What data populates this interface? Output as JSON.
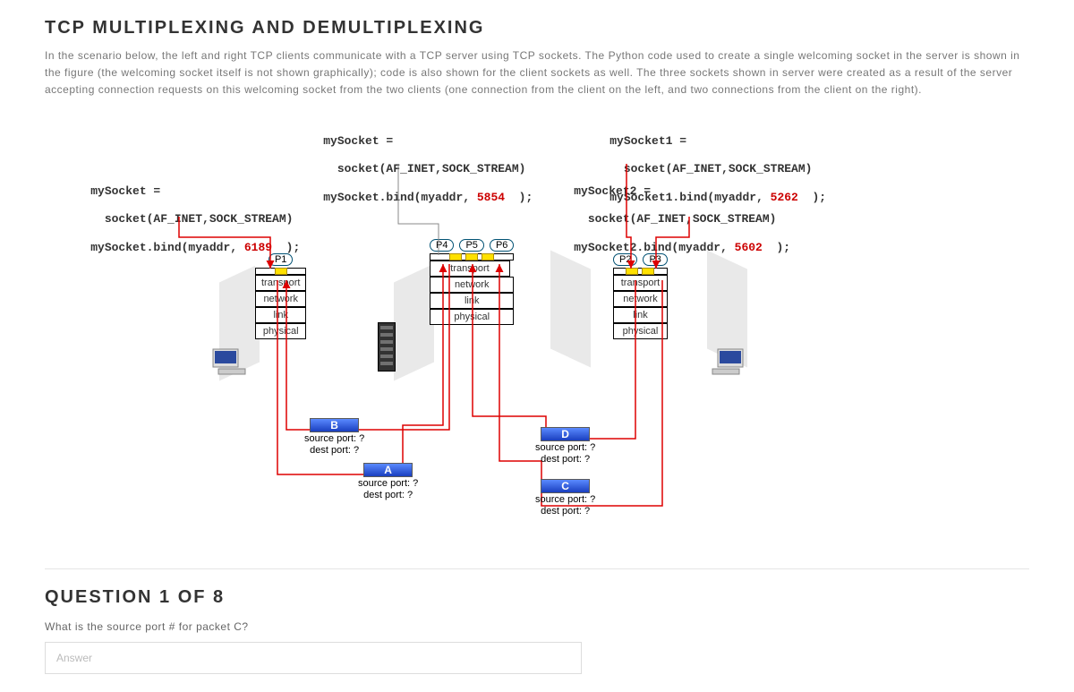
{
  "title": "TCP MULTIPLEXING AND DEMULTIPLEXING",
  "intro": "In the scenario below, the left and right TCP clients communicate with a TCP server using TCP sockets. The Python code used to create a single welcoming socket in the server is shown in the figure (the welcoming socket itself is not shown graphically); code is also shown for the client sockets as well. The three sockets shown in server were created as a result of the server accepting connection requests on this welcoming socket from the two clients (one connection from the client on the left, and two connections from the client on the right).",
  "code": {
    "left_client": "mySocket =\n  socket(AF_INET,SOCK_STREAM)\nmySocket.bind(myaddr, 6189  );",
    "server": "mySocket =\n  socket(AF_INET,SOCK_STREAM)\nmySocket.bind(myaddr, 5854  );",
    "right_sock1": "mySocket1 =\n  socket(AF_INET,SOCK_STREAM)\nmySocket1.bind(myaddr, 5262  );",
    "right_sock2": "mySocket2 =\n  socket(AF_INET,SOCK_STREAM)\nmySocket2.bind(myaddr, 5602  );"
  },
  "hosts": {
    "left": {
      "procs": [
        "P1"
      ],
      "layers": [
        "transport",
        "network",
        "link",
        "physical"
      ]
    },
    "server": {
      "procs": [
        "P4",
        "P5",
        "P6"
      ],
      "layers": [
        "transport",
        "network",
        "link",
        "physical"
      ]
    },
    "right": {
      "procs": [
        "P2",
        "P3"
      ],
      "layers": [
        "transport",
        "network",
        "link",
        "physical"
      ]
    }
  },
  "packets": {
    "A": {
      "label": "A",
      "src": "source port: ?",
      "dst": "dest port: ?"
    },
    "B": {
      "label": "B",
      "src": "source port: ?",
      "dst": "dest port: ?"
    },
    "C": {
      "label": "C",
      "src": "source port: ?",
      "dst": "dest port: ?"
    },
    "D": {
      "label": "D",
      "src": "source port: ?",
      "dst": "dest port: ?"
    }
  },
  "question": {
    "heading": "QUESTION 1 OF 8",
    "text": "What is the source port # for packet C?",
    "placeholder": "Answer"
  }
}
